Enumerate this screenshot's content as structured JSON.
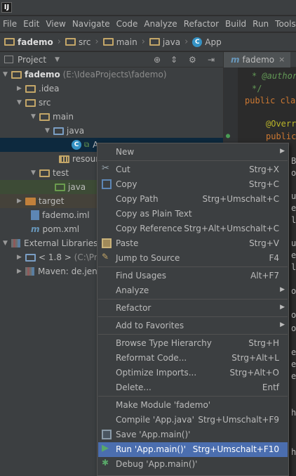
{
  "menubar": [
    "File",
    "Edit",
    "View",
    "Navigate",
    "Code",
    "Analyze",
    "Refactor",
    "Build",
    "Run",
    "Tools"
  ],
  "breadcrumb": {
    "items": [
      "fademo",
      "src",
      "main",
      "java"
    ],
    "file": "App"
  },
  "project_panel": {
    "title": "Project",
    "icons": [
      "target-icon",
      "split-icon",
      "gear-icon",
      "hide-icon"
    ]
  },
  "editor_tab": {
    "label": "fademo",
    "close": "×"
  },
  "tree": {
    "root_name": "fademo",
    "root_path": "(E:\\IdeaProjects\\fademo)",
    "idea": ".idea",
    "src": "src",
    "main": "main",
    "java": "java",
    "app_partial": "A",
    "resources_partial": "resourc",
    "test": "test",
    "test_java": "java",
    "target": "target",
    "iml": "fademo.iml",
    "pom": "pom.xml",
    "external_libraries": "External Libraries",
    "jdk": "< 1.8 >",
    "jdk_path": "(C:\\Pro",
    "maven": "Maven: de.jens"
  },
  "editor_code": {
    "l1": "* @author",
    "l2": "*/",
    "l3": "public cla",
    "l4": "@Overr",
    "l5": "public",
    "frags": [
      "Bo",
      "oo",
      "ut",
      "ea",
      "ly",
      "ut",
      "ea",
      "ly",
      "or",
      "or",
      "or",
      "ea",
      "ea",
      "ea",
      "hu",
      "hu"
    ]
  },
  "context_menu": {
    "new": "New",
    "cut": "Cut",
    "cut_sc": "Strg+X",
    "copy": "Copy",
    "copy_sc": "Strg+C",
    "copy_path": "Copy Path",
    "copy_path_sc": "Strg+Umschalt+C",
    "copy_plain": "Copy as Plain Text",
    "copy_ref": "Copy Reference",
    "copy_ref_sc": "Strg+Alt+Umschalt+C",
    "paste": "Paste",
    "paste_sc": "Strg+V",
    "jump": "Jump to Source",
    "jump_sc": "F4",
    "find_usages": "Find Usages",
    "find_usages_sc": "Alt+F7",
    "analyze": "Analyze",
    "refactor": "Refactor",
    "favorites": "Add to Favorites",
    "browse_hier": "Browse Type Hierarchy",
    "browse_hier_sc": "Strg+H",
    "reformat": "Reformat Code...",
    "reformat_sc": "Strg+Alt+L",
    "optimize": "Optimize Imports...",
    "optimize_sc": "Strg+Alt+O",
    "delete": "Delete...",
    "delete_sc": "Entf",
    "make_module": "Make Module 'fademo'",
    "compile": "Compile 'App.java'",
    "compile_sc": "Strg+Umschalt+F9",
    "save": "Save 'App.main()'",
    "run": "Run 'App.main()'",
    "run_sc": "Strg+Umschalt+F10",
    "debug": "Debug 'App.main()'"
  },
  "colors": {
    "background": "#2b2b2b",
    "panel": "#3c3f41",
    "selection": "#4b6eaf",
    "tree_selection": "#0d293e",
    "accent_blue": "#3592c4",
    "run_green": "#499c54",
    "folder": "#c3a668"
  }
}
